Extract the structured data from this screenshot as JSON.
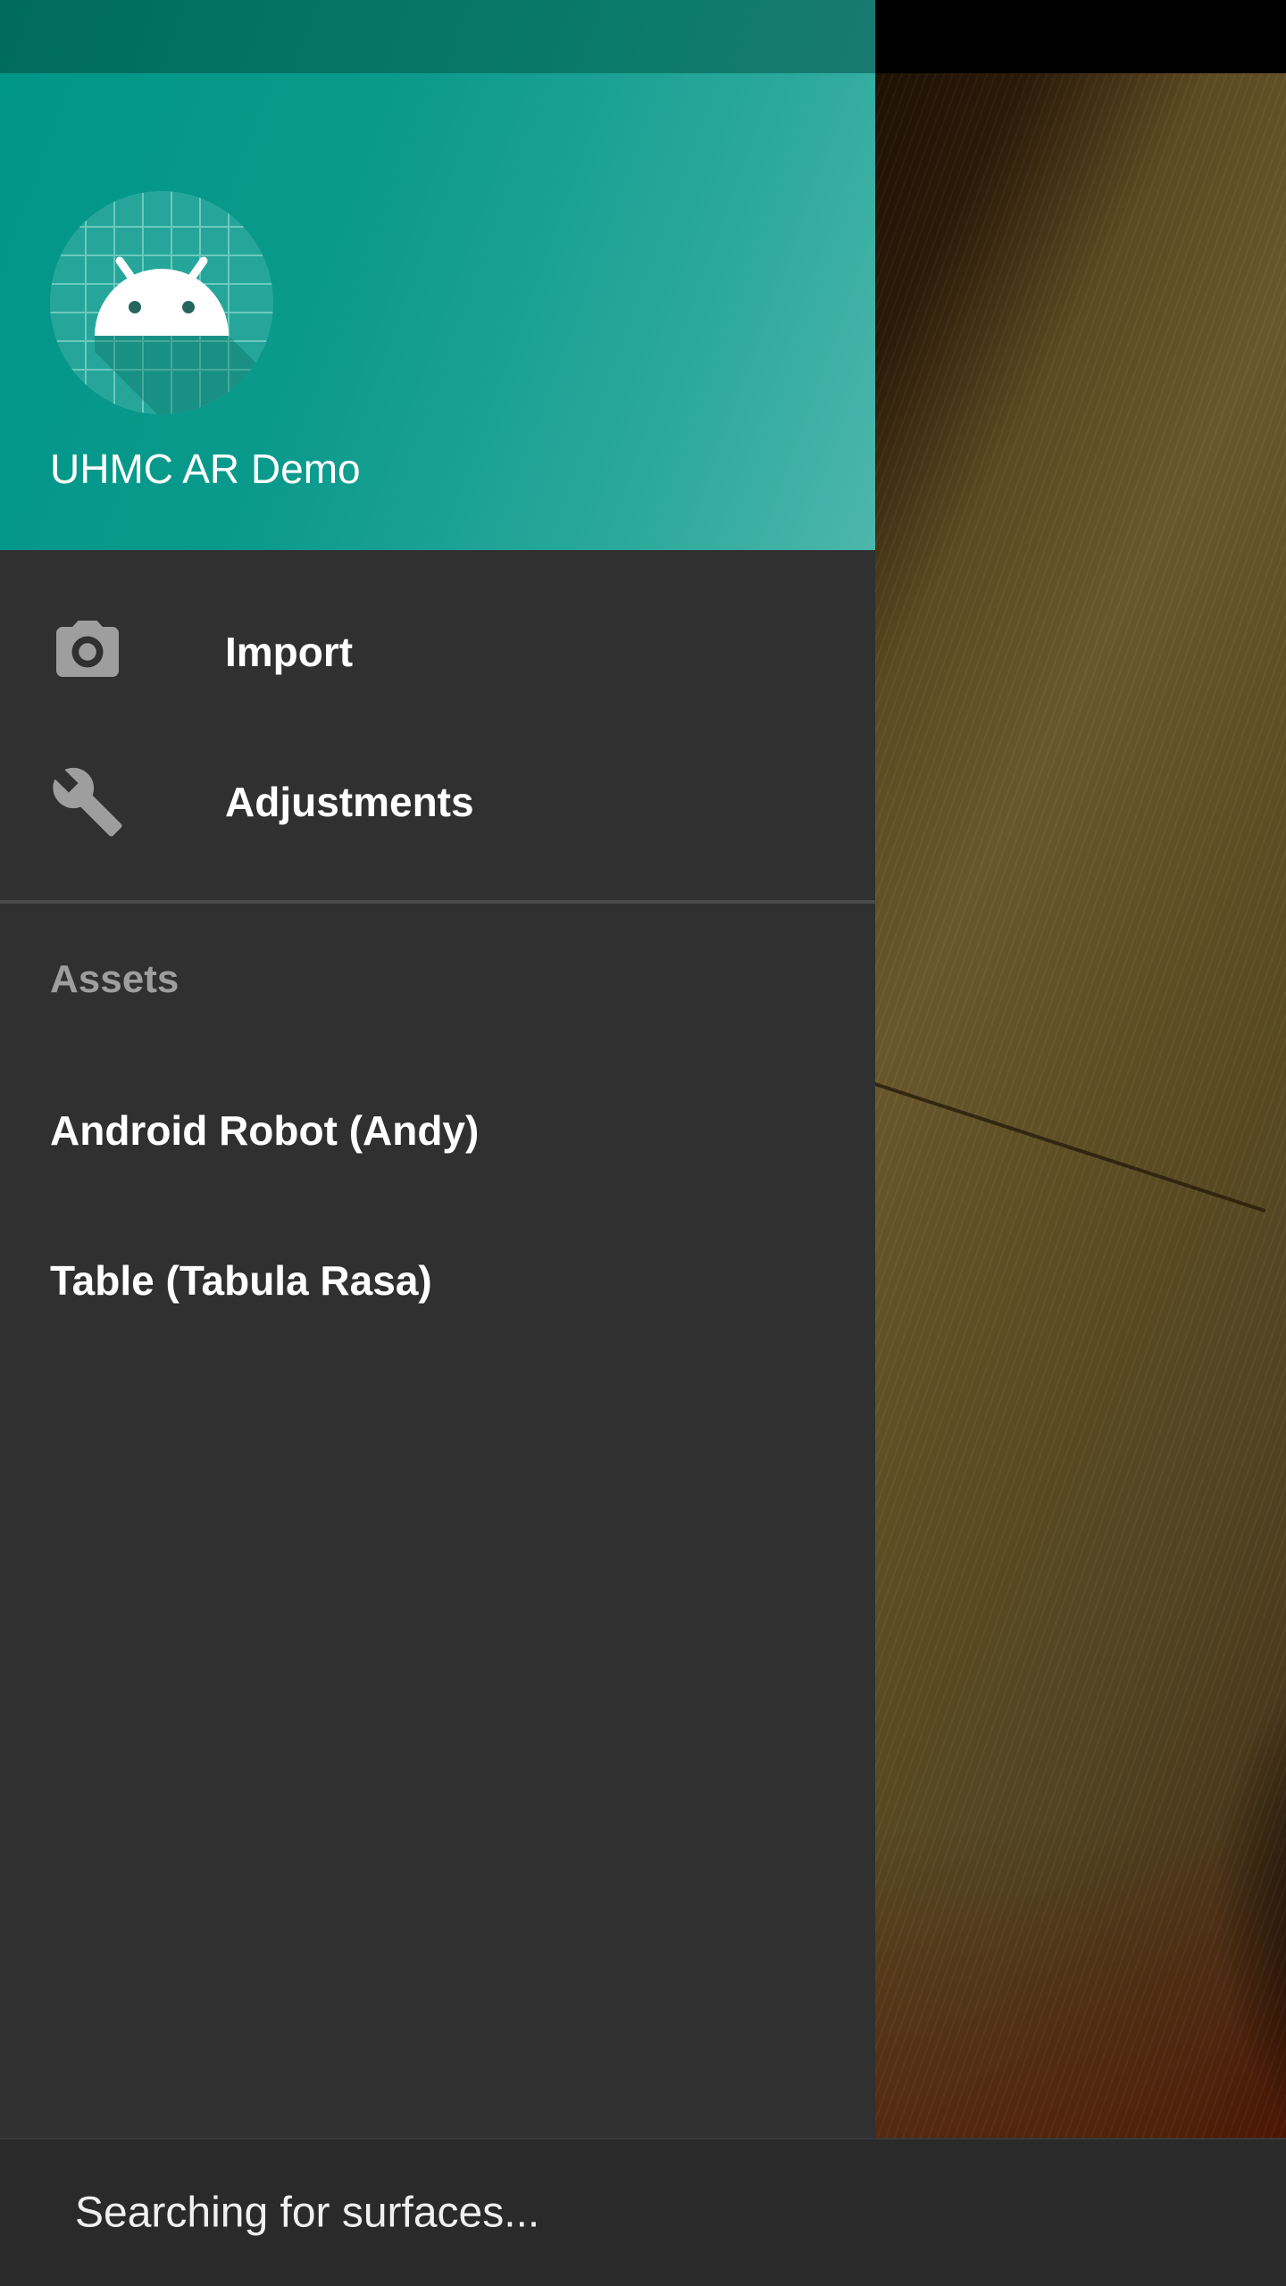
{
  "app": {
    "title": "UHMC AR Demo",
    "accent_color": "#009688",
    "avatar_icon": "android-robot-icon"
  },
  "menu": {
    "items": [
      {
        "label": "Import",
        "icon": "camera-icon"
      },
      {
        "label": "Adjustments",
        "icon": "wrench-icon"
      }
    ]
  },
  "assets": {
    "section_title": "Assets",
    "items": [
      {
        "label": "Android Robot (Andy)"
      },
      {
        "label": "Table (Tabula Rasa)"
      }
    ]
  },
  "snackbar": {
    "message": "Searching for surfaces..."
  }
}
